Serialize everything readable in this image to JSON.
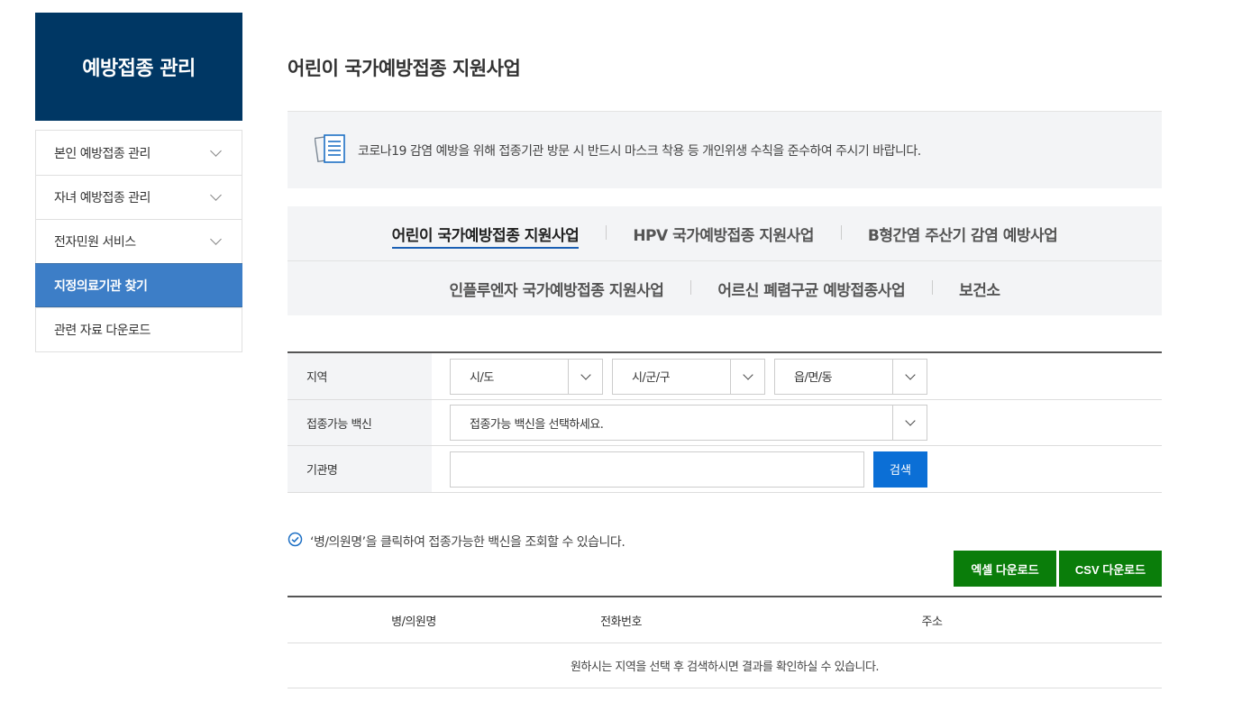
{
  "sidebar": {
    "title": "예방접종 관리",
    "items": [
      {
        "label": "본인 예방접종 관리"
      },
      {
        "label": "자녀 예방접종 관리"
      },
      {
        "label": "전자민원 서비스"
      },
      {
        "label": "지정의료기관 찾기"
      },
      {
        "label": "관련 자료 다운로드"
      }
    ]
  },
  "main": {
    "title": "어린이 국가예방접종 지원사업",
    "notice": "코로나19 감염 예방을 위해 접종기관 방문 시 반드시 마스크 착용 등 개인위생 수칙을 준수하여 주시기 바랍니다.",
    "tabs": [
      {
        "label": "어린이 국가예방접종 지원사업"
      },
      {
        "label": "HPV 국가예방접종 지원사업"
      },
      {
        "label": "B형간염 주산기 감염 예방사업"
      },
      {
        "label": "인플루엔자 국가예방접종 지원사업"
      },
      {
        "label": "어르신 폐렴구균 예방접종사업"
      },
      {
        "label": "보건소"
      }
    ],
    "form": {
      "region_label": "지역",
      "sido": "시/도",
      "sigungu": "시/군/구",
      "eupmyeondong": "읍/면/동",
      "vaccine_label": "접종가능 백신",
      "vaccine_select": "접종가능 백신을 선택하세요.",
      "org_label": "기관명",
      "org_value": "",
      "search_button": "검색"
    },
    "hint": "‘병/의원명’을 클릭하여 접종가능한 백신을 조회할 수 있습니다.",
    "download": {
      "excel": "엑셀 다운로드",
      "csv": "CSV 다운로드"
    },
    "table": {
      "headers": [
        "병/의원명",
        "전화번호",
        "주소"
      ],
      "empty_message": "원하시는 지역을 선택 후 검색하시면 결과를 확인하실 수 있습니다."
    }
  },
  "colors": {
    "sidebar_head": "#003764",
    "active_menu": "#3d7ec7",
    "search_button": "#0b6fd6",
    "download_button": "#0a7d0a"
  }
}
